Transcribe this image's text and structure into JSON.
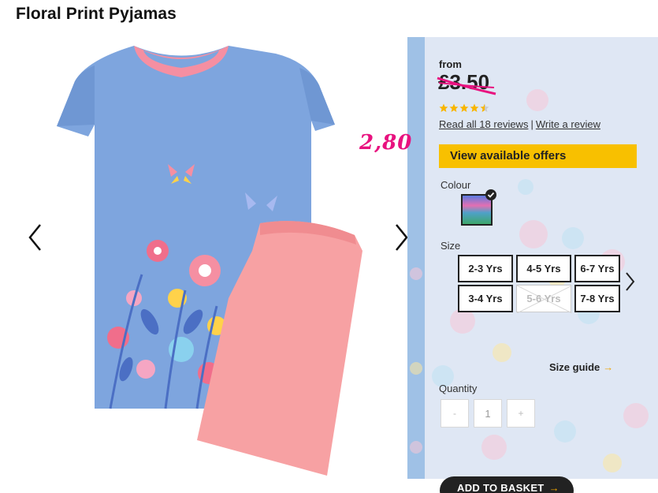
{
  "product": {
    "title": "Floral Print Pyjamas"
  },
  "pricing": {
    "from_label": "from",
    "price": "£3.50",
    "handwritten_price": "2,80",
    "rating": 4.5,
    "reviews_link": "Read all 18 reviews",
    "separator": "|",
    "write_review_link": "Write a review",
    "offers_label": "View available offers"
  },
  "colour": {
    "label": "Colour"
  },
  "size": {
    "label": "Size",
    "options": [
      {
        "label": "2-3 Yrs",
        "available": true
      },
      {
        "label": "4-5 Yrs",
        "available": true
      },
      {
        "label": "6-7 Yrs",
        "available": true
      },
      {
        "label": "3-4 Yrs",
        "available": true
      },
      {
        "label": "5-6 Yrs",
        "available": false
      },
      {
        "label": "7-8 Yrs",
        "available": true
      }
    ],
    "guide_label": "Size guide",
    "guide_arrow": "→"
  },
  "quantity": {
    "label": "Quantity",
    "minus": "-",
    "value": "1",
    "plus": "+"
  },
  "basket": {
    "label": "ADD TO BASKET",
    "arrow": "→"
  },
  "colors": {
    "offers_bg": "#f8c000",
    "handwriting": "#e8127f",
    "panel_bg": "#dfe7f4"
  }
}
